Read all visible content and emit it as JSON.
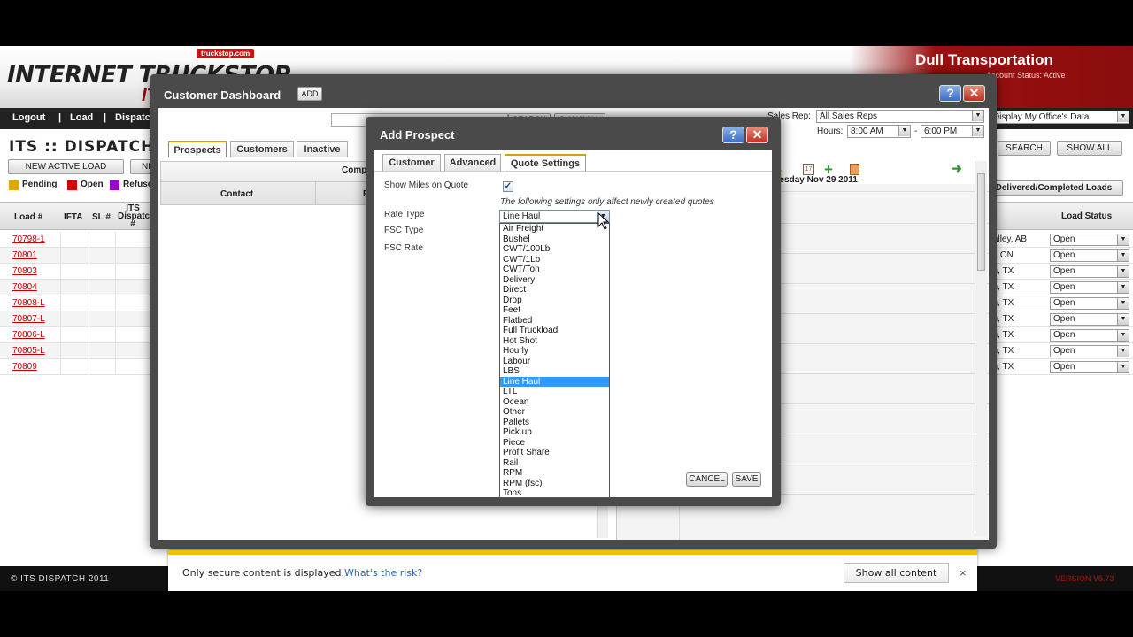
{
  "app": {
    "logo_text": "INTERNET TRUCKSTOP",
    "logo_sub": "ITS",
    "logo_url": "truckstop.com",
    "company_name": "Dull Transportation",
    "account_status": "Account Status: Active",
    "nav": [
      "Logout",
      "|",
      "Load",
      "|",
      "Dispatch"
    ],
    "page_title": "ITS :: DISPATCH",
    "new_active_load": "NEW ACTIVE LOAD",
    "new_btn": "NE",
    "legend": [
      {
        "label": "Pending",
        "color": "#e0a800"
      },
      {
        "label": "Open",
        "color": "#d40000"
      },
      {
        "label": "Refuse",
        "color": "#9a00c8"
      }
    ],
    "columns": [
      "Load #",
      "IFTA",
      "SL #",
      "ITS Dispatch #"
    ],
    "loads": [
      "70798-1",
      "70801",
      "70803",
      "70804",
      "70808-L",
      "70807-L",
      "70806-L",
      "70805-L",
      "70809"
    ],
    "display_filter": "Display My Office's Data",
    "search_btn": "SEARCH",
    "show_all_btn": "SHOW ALL",
    "delivered_tab": "Delivered/Completed Loads",
    "load_status_header": "Load Status",
    "right_rows": [
      {
        "city": "Valley, AB",
        "status": "Open"
      },
      {
        "city": "to, ON",
        "status": "Open"
      },
      {
        "city": "on, TX",
        "status": "Open"
      },
      {
        "city": "on, TX",
        "status": "Open"
      },
      {
        "city": "on, TX",
        "status": "Open"
      },
      {
        "city": "on, TX",
        "status": "Open"
      },
      {
        "city": "on, TX",
        "status": "Open"
      },
      {
        "city": "on, TX",
        "status": "Open"
      },
      {
        "city": "on, TX",
        "status": "Open"
      }
    ],
    "footer_left": "© ITS DISPATCH 2011",
    "footer_right": "VERSION V5.73"
  },
  "dashboard": {
    "title": "Customer Dashboard",
    "add_btn": "ADD",
    "search_btn": "SEARCH",
    "show_all_btn": "SHOW ALL",
    "sales_rep_label": "Sales Rep:",
    "sales_rep_value": "All Sales Reps",
    "hours_label": "Hours:",
    "hours_from": "8:00 AM",
    "hours_to": "6:00 PM",
    "hours_sep": "-",
    "tabs": [
      "Prospects",
      "Customers",
      "Inactive"
    ],
    "col_company": "Compa",
    "col_contact": "Contact",
    "col_phone": "Ph",
    "date": "Tuesday Nov 29 2011"
  },
  "prospect": {
    "title": "Add Prospect",
    "tabs": [
      "Customer",
      "Advanced",
      "Quote Settings"
    ],
    "show_miles_label": "Show Miles on Quote",
    "show_miles_checked": "✓",
    "note": "The following settings only affect newly created quotes",
    "rate_type_label": "Rate Type",
    "fsc_type_label": "FSC Type",
    "fsc_rate_label": "FSC Rate",
    "rate_type_value": "Line Haul",
    "rate_options": [
      "Air Freight",
      "Bushel",
      "CWT/100Lb",
      "CWT/1Lb",
      "CWT/Ton",
      "Delivery",
      "Direct",
      "Drop",
      "Feet",
      "Flatbed",
      "Full Truckload",
      "Hot Shot",
      "Hourly",
      "Labour",
      "LBS",
      "Line Haul",
      "LTL",
      "Ocean",
      "Other",
      "Pallets",
      "Pick up",
      "Piece",
      "Profit Share",
      "Rail",
      "RPM",
      "RPM (fsc)",
      "Tons"
    ],
    "selected_option": "Line Haul",
    "cancel_btn": "CANCEL",
    "save_btn": "SAVE"
  },
  "infobar": {
    "message": "Only secure content is displayed.",
    "link": "What's the risk?",
    "button": "Show all content",
    "close": "×"
  },
  "colors": {
    "brand_red": "#8a0d0d",
    "dialog_gray": "#4a4a4a",
    "selection_blue": "#3399ff",
    "infobar_yellow": "#f0c000"
  }
}
